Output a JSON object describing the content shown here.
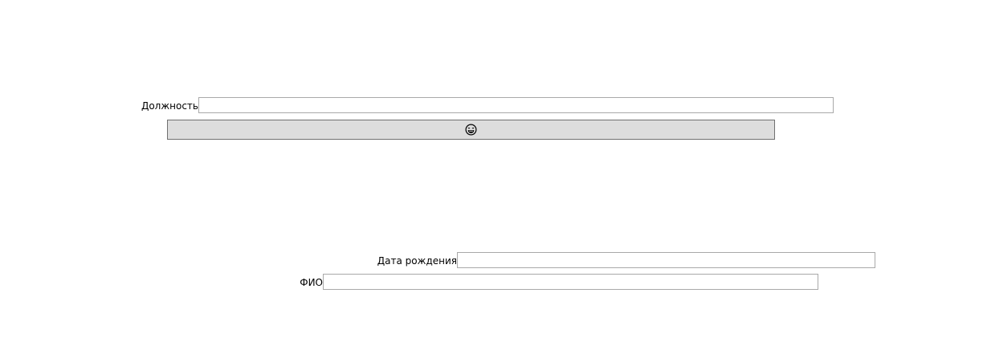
{
  "form": {
    "position_label": "Должность",
    "position_value": "",
    "birthdate_label": "Дата рождения",
    "birthdate_value": "",
    "fullname_label": "ФИО",
    "fullname_value": ""
  },
  "action_button": {
    "icon": "laughing-face-icon"
  }
}
